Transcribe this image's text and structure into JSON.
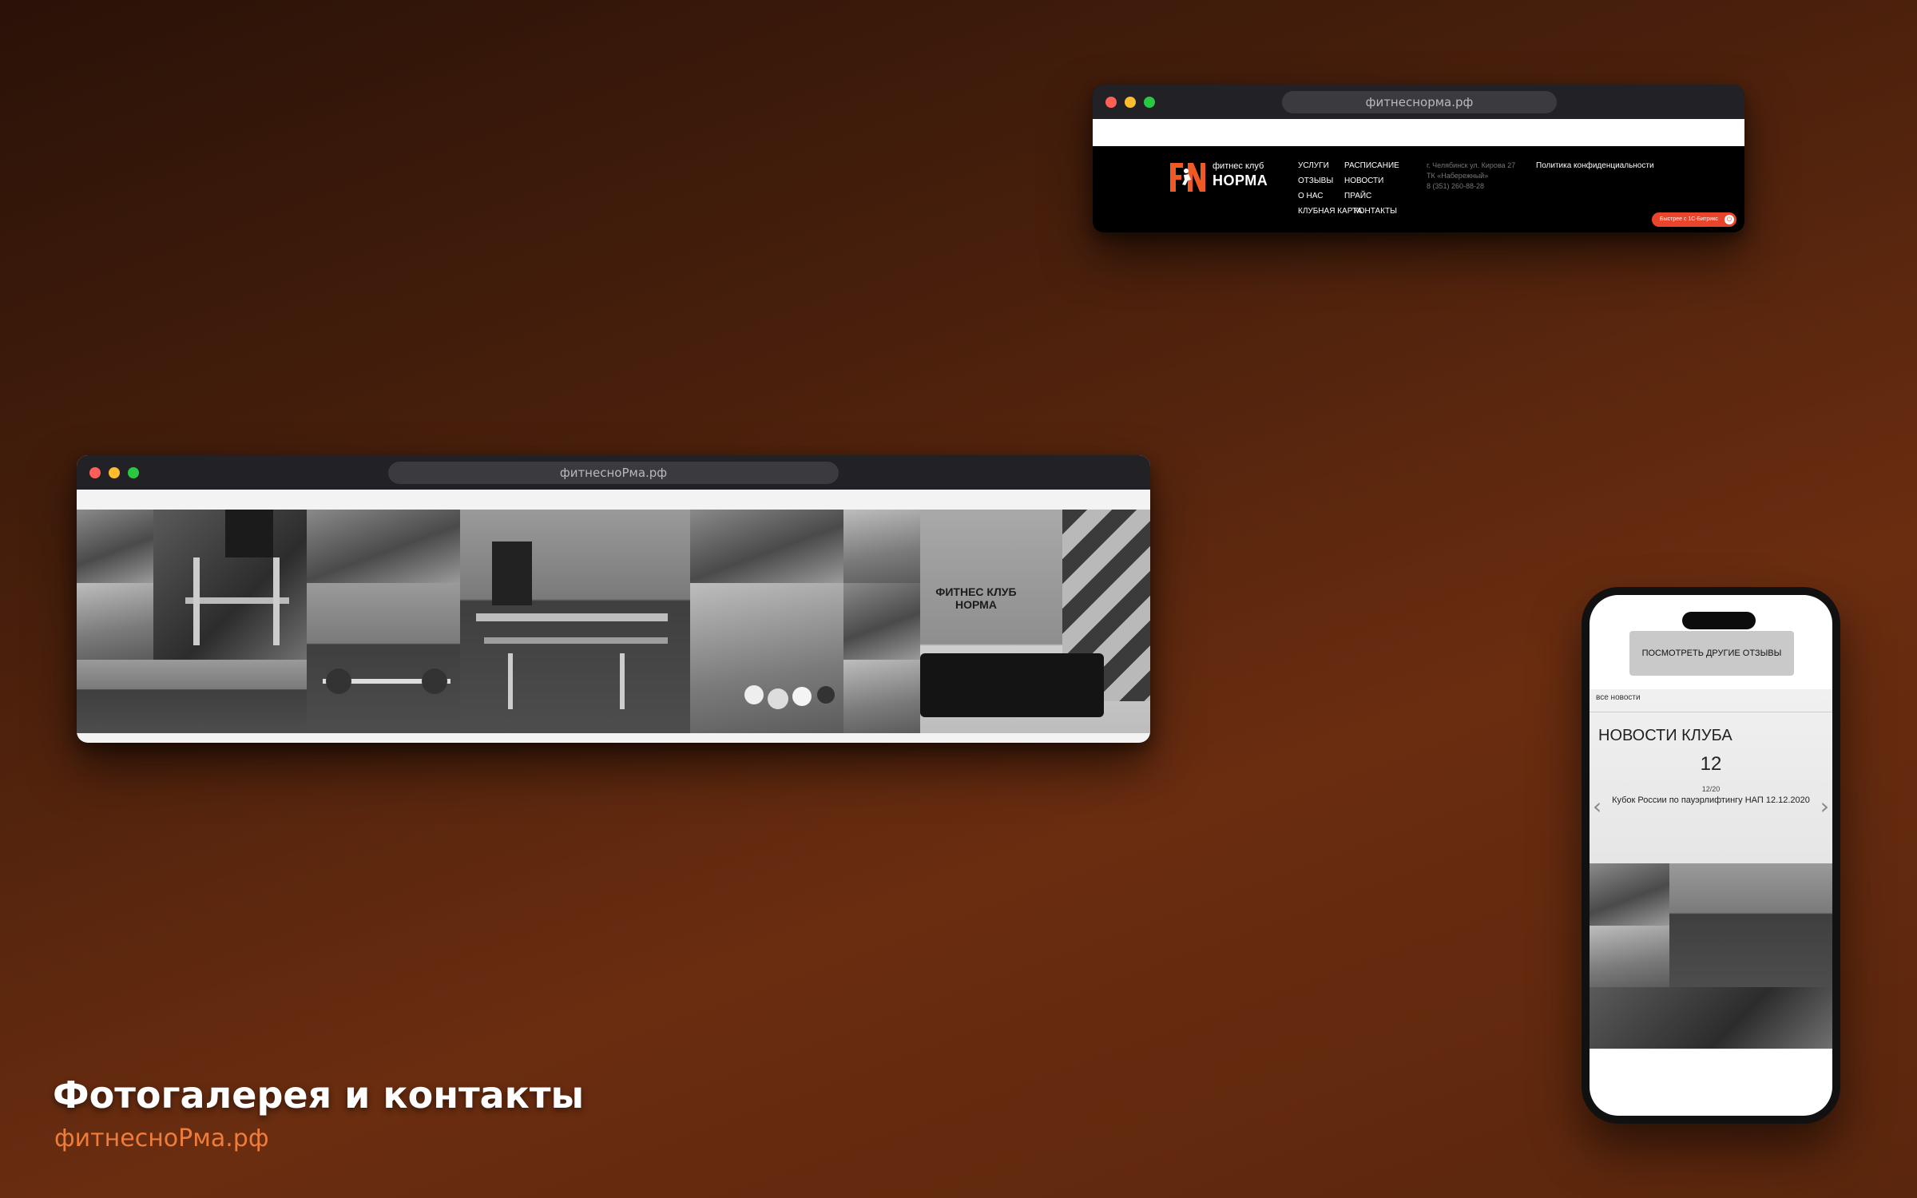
{
  "footer_window": {
    "url": "фитнеснорма.рф",
    "logo": {
      "small_text": "фитнес клуб",
      "big_text": "НОРМА",
      "mark": "FN"
    },
    "nav_col1": [
      "УСЛУГИ",
      "ОТЗЫВЫ",
      "О НАС",
      "КЛУБНАЯ КАРТА"
    ],
    "nav_col2": [
      "РАСПИСАНИЕ",
      "НОВОСТИ",
      "ПРАЙС",
      "КОНТАКТЫ"
    ],
    "address": [
      "г. Челябинск ул. Кирова 27",
      "ТК «Набережный»",
      "8 (351) 260-88-28"
    ],
    "policy": "Политика конфиденциальности",
    "bitrix_badge": "Быстрее с 1С-Битрикс",
    "bitrix_icon": "power-icon",
    "accent_color": "#e8452c"
  },
  "gallery_window": {
    "url": "фитнесноРма.рф",
    "lounge_sign": "ФИТНЕС КЛУБ НОРМА"
  },
  "phone": {
    "other_reviews_button": "ПОСМОТРЕТЬ ДРУГИЕ ОТЗЫВЫ",
    "all_news_link": "все новости",
    "news_heading": "НОВОСТИ КЛУБА",
    "news_day": "12",
    "news_month_year": "12/20",
    "news_title": "Кубок России по пауэрлифтингу НАП 12.12.2020",
    "prev_arrow": "‹",
    "next_arrow": "›"
  },
  "caption": {
    "title": "Фотогалерея и контакты",
    "url": "фитнесноРма.рф",
    "url_color": "#ee7d3c"
  }
}
